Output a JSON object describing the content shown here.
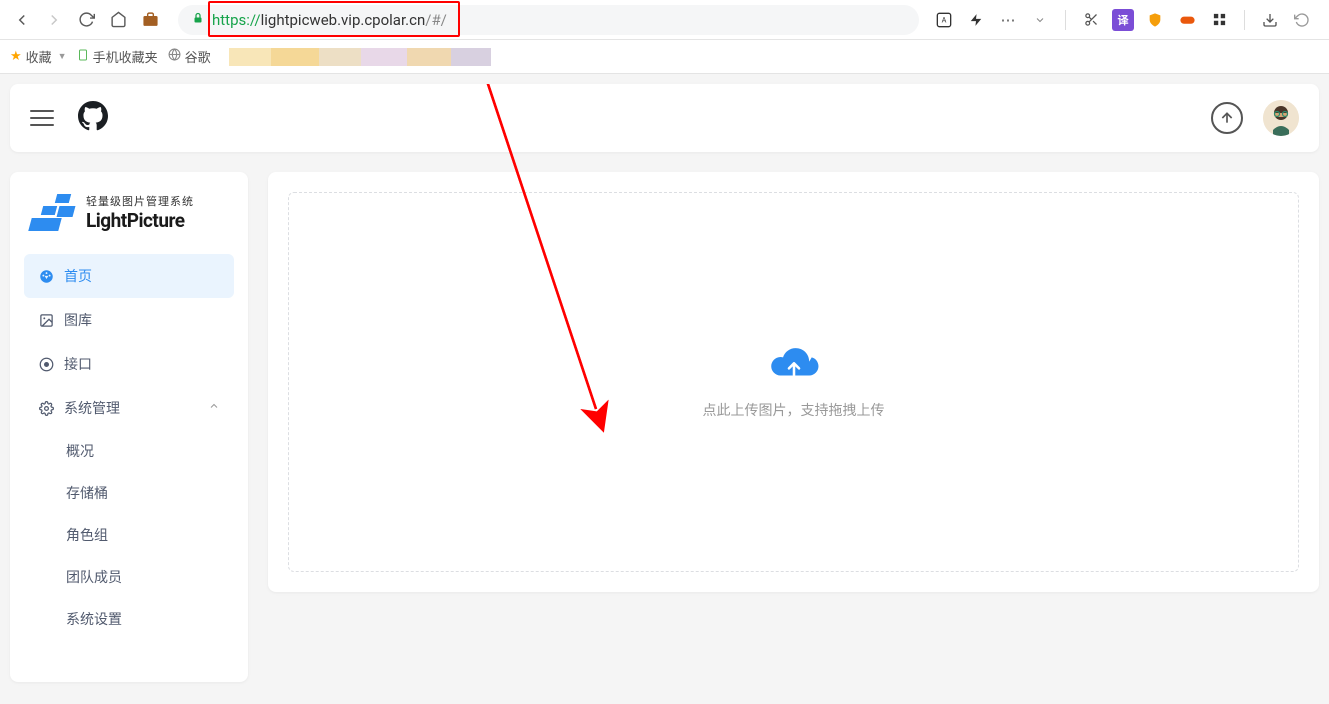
{
  "browser": {
    "url_protocol": "https://",
    "url_host": "lightpicweb.vip.cpolar.cn",
    "url_path": "/#/"
  },
  "bookmarks": {
    "fav_label": "收藏",
    "mobile_label": "手机收藏夹",
    "google_label": "谷歌"
  },
  "logo": {
    "subtitle": "轻量级图片管理系统",
    "title": "LightPicture"
  },
  "sidebar": {
    "home": "首页",
    "gallery": "图库",
    "api": "接口",
    "system": "系统管理",
    "sub": {
      "overview": "概况",
      "storage": "存储桶",
      "roles": "角色组",
      "team": "团队成员",
      "settings": "系统设置"
    }
  },
  "upload": {
    "hint": "点此上传图片，支持拖拽上传"
  }
}
